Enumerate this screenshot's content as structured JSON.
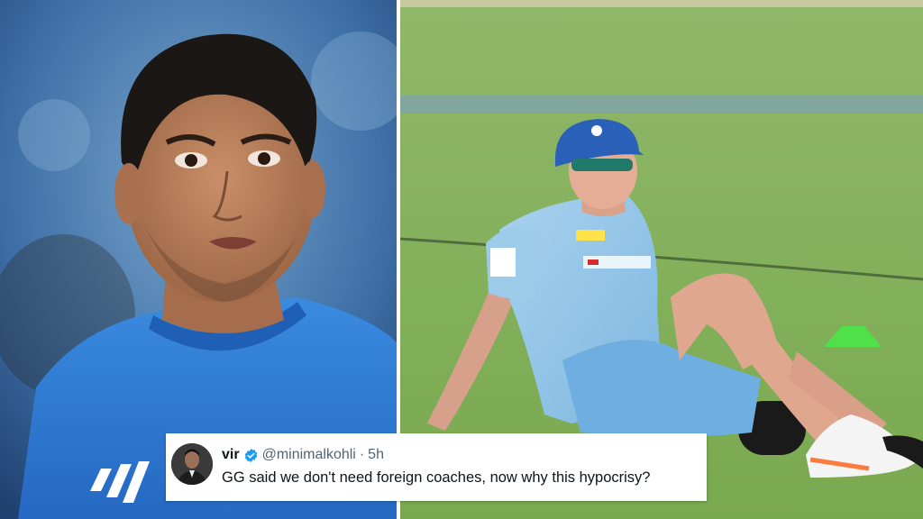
{
  "tweet": {
    "name": "vir",
    "handle": "@minimalkohli",
    "separator": "·",
    "time": "5h",
    "text": "GG said we don't need foreign coaches, now why this hypocrisy?"
  },
  "icons": {
    "verified": "verified-badge-icon",
    "avatar": "avatar"
  },
  "colors": {
    "jersey_left": "#2f7fd8",
    "jersey_right": "#8ec2e6",
    "grass": "#7fb054",
    "verified_blue": "#1d9bf0",
    "text_dark": "#0f1419",
    "text_grey": "#536471"
  }
}
